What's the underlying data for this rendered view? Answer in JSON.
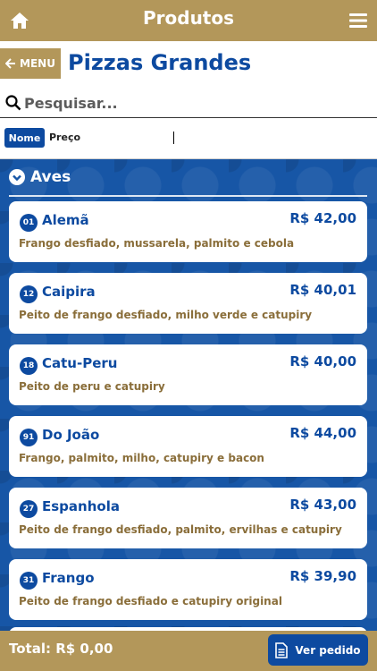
{
  "topbar": {
    "title": "Produtos"
  },
  "header": {
    "menu_label": "MENU",
    "page_title": "Pizzas Grandes"
  },
  "search": {
    "placeholder": "Pesquisar..."
  },
  "sort": {
    "nome_label": "Nome",
    "preco_label": "Preço"
  },
  "category": {
    "name": "Aves"
  },
  "items": [
    {
      "code": "01",
      "name": "Alemã",
      "price": "R$ 42,00",
      "desc": "Frango desfiado, mussarela, palmito e cebola"
    },
    {
      "code": "12",
      "name": "Caipira",
      "price": "R$ 40,01",
      "desc": "Peito de frango desfiado, milho verde e catupiry"
    },
    {
      "code": "18",
      "name": "Catu-Peru",
      "price": "R$ 40,00",
      "desc": "Peito de peru e catupiry"
    },
    {
      "code": "91",
      "name": "Do João",
      "price": "R$ 44,00",
      "desc": "Frango, palmito, milho, catupiry e bacon"
    },
    {
      "code": "27",
      "name": "Espanhola",
      "price": "R$ 43,00",
      "desc": "Peito de frango desfiado, palmito, ervilhas e catupiry"
    },
    {
      "code": "31",
      "name": "Frango",
      "price": "R$ 39,90",
      "desc": "Peito de frango desfiado e catupiry original"
    }
  ],
  "footer": {
    "total_label": "Total: R$ 0,00",
    "order_button": "Ver pedido"
  },
  "colors": {
    "gold": "#b3975a",
    "blue": "#0d4aa0",
    "desc_brown": "#8a6e3a"
  },
  "icons": [
    "home-icon",
    "hamburger-menu-icon",
    "arrow-left-icon",
    "search-icon",
    "chevron-down-circle-icon",
    "document-icon"
  ]
}
